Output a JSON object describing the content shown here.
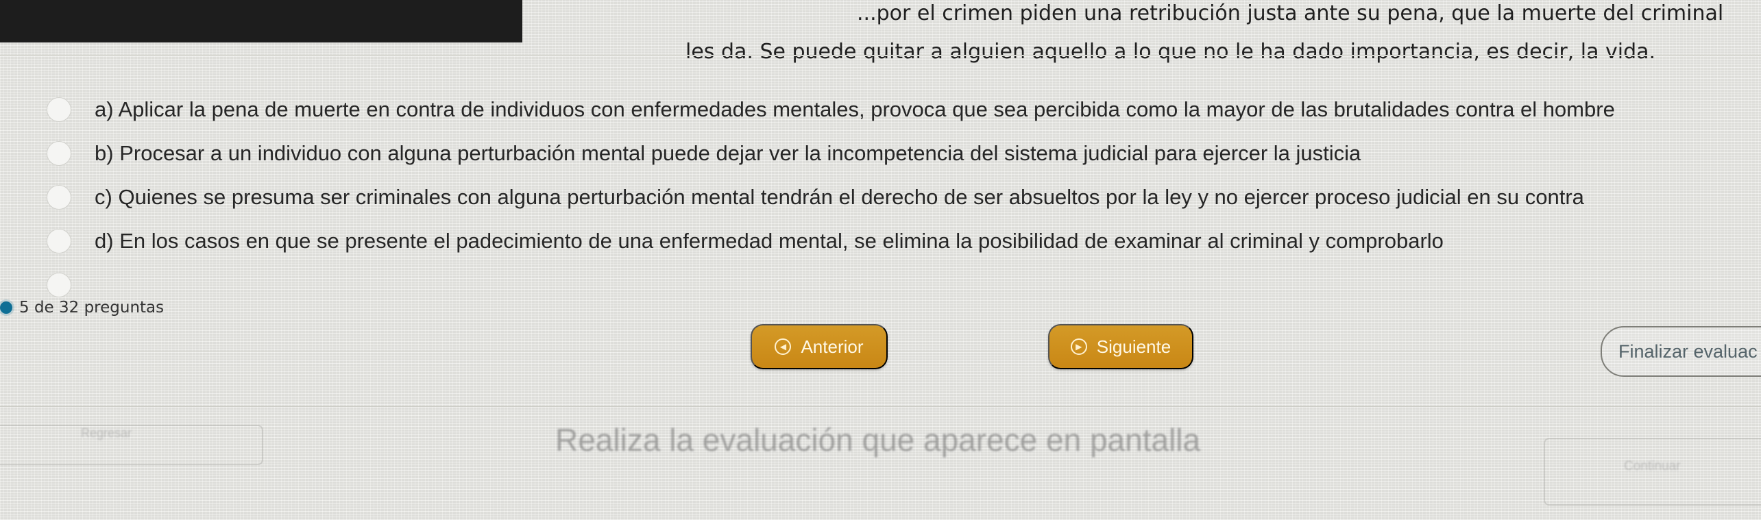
{
  "question": {
    "line1": "...por el crimen piden una retribución justa ante su pena, que la muerte del criminal",
    "line2": "les da. Se puede quitar a alguien aquello a lo que no le ha dado importancia, es decir, la vida."
  },
  "options": [
    {
      "letter": "a)",
      "text": "Aplicar la pena de muerte en contra de individuos con enfermedades mentales, provoca que sea percibida como la mayor de las brutalidades contra el hombre"
    },
    {
      "letter": "b)",
      "text": "Procesar a un individuo con alguna perturbación mental puede dejar ver la incompetencia del sistema judicial para ejercer la justicia"
    },
    {
      "letter": "c)",
      "text": "Quienes se presuma ser criminales con alguna perturbación mental tendrán el derecho de ser absueltos por la ley y no ejercer proceso judicial en su contra"
    },
    {
      "letter": "d)",
      "text": "En los casos en que se presente el padecimiento de una enfermedad mental, se elimina la posibilidad de examinar al criminal y comprobarlo"
    }
  ],
  "progress": {
    "text": "5 de 32 preguntas",
    "current": 5,
    "total": 32
  },
  "navigation": {
    "previous": "Anterior",
    "next": "Siguiente",
    "finish": "Finalizar evaluac"
  },
  "footer": {
    "title": "Realiza la evaluación que aparece en pantalla",
    "left_label": "Regresar",
    "right_label": "Continuar"
  },
  "colors": {
    "accent": "#c98715",
    "progress": "#0f6f95"
  }
}
